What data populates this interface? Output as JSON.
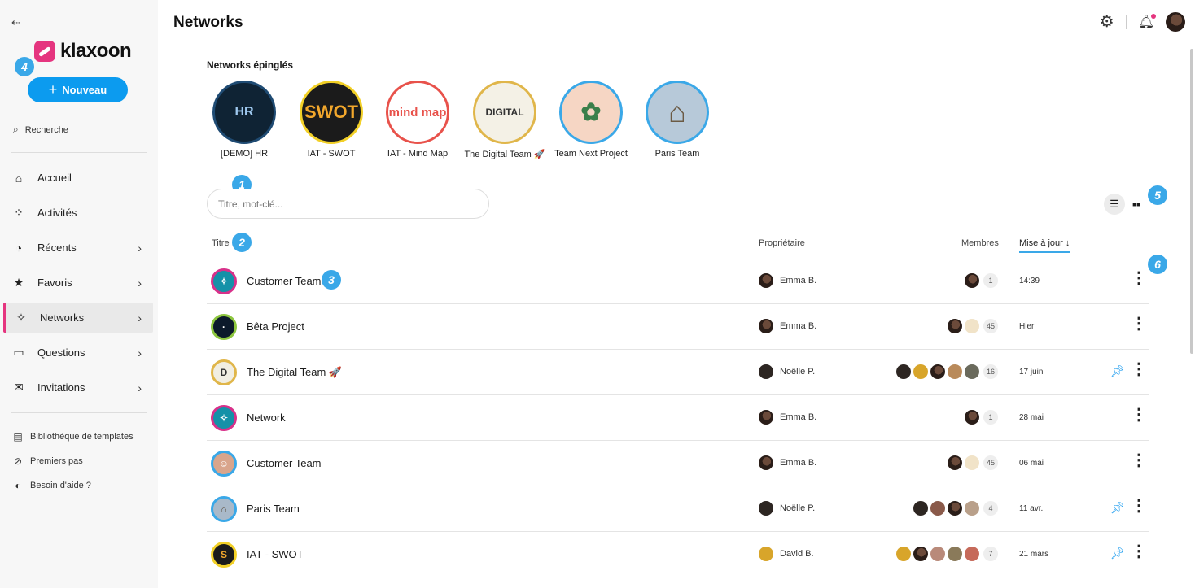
{
  "sidebar": {
    "collapse_glyph": "⇠",
    "logo_text": "klaxoon",
    "new_button": "Nouveau",
    "search_label": "Recherche",
    "items": [
      {
        "label": "Accueil",
        "icon": "home-icon",
        "glyph": "⌂"
      },
      {
        "label": "Activités",
        "icon": "grid-icon",
        "glyph": "⁘"
      },
      {
        "label": "Récents",
        "icon": "clock-icon",
        "glyph": "◔"
      },
      {
        "label": "Favoris",
        "icon": "star-icon",
        "glyph": "★"
      },
      {
        "label": "Networks",
        "icon": "network-icon",
        "glyph": "✧"
      },
      {
        "label": "Questions",
        "icon": "inbox-icon",
        "glyph": "▭"
      },
      {
        "label": "Invitations",
        "icon": "mail-icon",
        "glyph": "✉"
      }
    ],
    "footer_items": [
      {
        "label": "Bibliothèque de templates",
        "icon": "template-icon",
        "glyph": "▤"
      },
      {
        "label": "Premiers pas",
        "icon": "compass-icon",
        "glyph": "⊘"
      },
      {
        "label": "Besoin d'aide ?",
        "icon": "help-icon",
        "glyph": "◐"
      }
    ]
  },
  "header": {
    "title": "Networks"
  },
  "badges": {
    "b1": "1",
    "b2": "2",
    "b3": "3",
    "b4": "4",
    "b5": "5",
    "b6": "6"
  },
  "pinned": {
    "title": "Networks épinglés",
    "items": [
      {
        "label": "[DEMO] HR",
        "border": "#1f4b73",
        "bg": "#0f2334",
        "text": "HR",
        "color": "#9fc9ef"
      },
      {
        "label": "IAT - SWOT",
        "border": "#f2d027",
        "bg": "#1b1b1b",
        "text": "SWOT",
        "color": "#f2a72c"
      },
      {
        "label": "IAT - Mind Map",
        "border": "#e8524b",
        "bg": "#ffffff",
        "text": "mind map",
        "color": "#e8524b"
      },
      {
        "label": "The Digital Team 🚀",
        "border": "#e0b64a",
        "bg": "#f4f1e6",
        "text": "DIGITAL",
        "color": "#333333"
      },
      {
        "label": "Team Next Project",
        "border": "#3aa8e8",
        "bg": "#f6d6c4",
        "text": "✿",
        "color": "#3a7f4a"
      },
      {
        "label": "Paris Team",
        "border": "#3aa8e8",
        "bg": "#b7c9d9",
        "text": "⌂",
        "color": "#6b5a44"
      }
    ]
  },
  "filter": {
    "placeholder": "Titre, mot-clé..."
  },
  "table": {
    "headers": {
      "title": "Titre",
      "owner": "Propriétaire",
      "members": "Membres",
      "updated": "Mise à jour ↓"
    },
    "rows": [
      {
        "title": "Customer Team",
        "owner": "Emma B.",
        "count": "1",
        "avatars": 1,
        "date": "14:39",
        "pinned": false,
        "ring": "#d8318a",
        "fill": "#1591a8",
        "glyph": "✧"
      },
      {
        "title": "Bêta Project",
        "owner": "Emma B.",
        "count": "45",
        "avatars": 2,
        "date": "Hier",
        "pinned": false,
        "ring": "#8dc63f",
        "fill": "#0c1a2b",
        "glyph": "·"
      },
      {
        "title": "The Digital Team 🚀",
        "owner": "Noëlle P.",
        "count": "16",
        "avatars": 5,
        "date": "17 juin",
        "pinned": true,
        "ring": "#e0b64a",
        "fill": "#f1eee2",
        "glyph": "D"
      },
      {
        "title": "Network",
        "owner": "Emma B.",
        "count": "1",
        "avatars": 1,
        "date": "28 mai",
        "pinned": false,
        "ring": "#d8318a",
        "fill": "#1591a8",
        "glyph": "✧"
      },
      {
        "title": "Customer Team",
        "owner": "Emma B.",
        "count": "45",
        "avatars": 2,
        "date": "06 mai",
        "pinned": false,
        "ring": "#3aa8e8",
        "fill": "#d9a58c",
        "glyph": "☺"
      },
      {
        "title": "Paris Team",
        "owner": "Noëlle P.",
        "count": "4",
        "avatars": 4,
        "date": "11 avr.",
        "pinned": true,
        "ring": "#3aa8e8",
        "fill": "#a9b9c9",
        "glyph": "⌂"
      },
      {
        "title": "IAT - SWOT",
        "owner": "David B.",
        "count": "7",
        "avatars": 5,
        "date": "21 mars",
        "pinned": true,
        "ring": "#f2d027",
        "fill": "#1b1b1b",
        "glyph": "S"
      }
    ]
  },
  "colors": {
    "accent": "#0c9bef",
    "brand": "#e5357f",
    "badge": "#3aa8e8"
  }
}
